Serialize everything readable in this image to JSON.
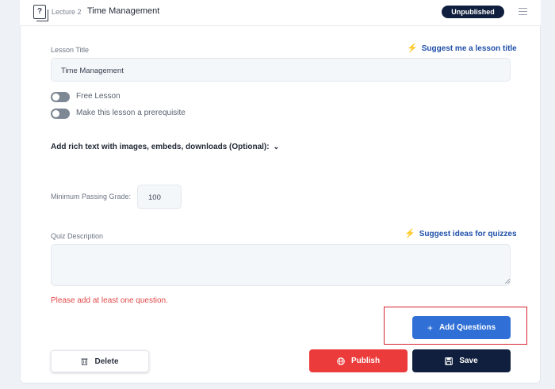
{
  "header": {
    "lecture_number": "Lecture 2",
    "lecture_title": "Time Management",
    "status_badge": "Unpublished"
  },
  "lesson": {
    "title_label": "Lesson Title",
    "suggest_title_link": "Suggest me a lesson title",
    "title_value": "Time Management",
    "free_lesson_label": "Free Lesson",
    "prerequisite_label": "Make this lesson a prerequisite",
    "rich_text_label": "Add rich text with images, embeds, downloads (Optional):"
  },
  "quiz": {
    "min_grade_label": "Minimum Passing Grade:",
    "min_grade_value": "100",
    "description_label": "Quiz Description",
    "suggest_quiz_link": "Suggest ideas for quizzes",
    "description_value": "",
    "error_message": "Please add at least one question."
  },
  "actions": {
    "add_questions": "Add Questions",
    "delete": "Delete",
    "publish": "Publish",
    "save": "Save"
  },
  "colors": {
    "accent_blue": "#2f6fd6",
    "publish_red": "#ec3b3b",
    "navy": "#0f1f3d",
    "error_red": "#e04848",
    "highlight_red": "#d8242e"
  },
  "icons": [
    "lecture-icon",
    "menu-icon",
    "magic-wand-icon",
    "chevron-down-icon",
    "plus-icon",
    "trash-icon",
    "globe-icon",
    "save-icon"
  ]
}
